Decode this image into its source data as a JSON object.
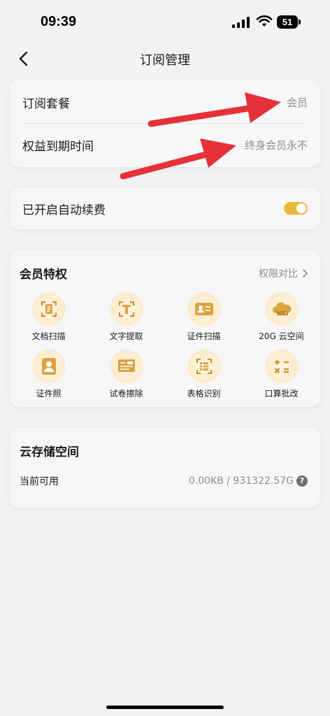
{
  "status": {
    "time": "09:39",
    "battery": "51"
  },
  "nav": {
    "title": "订阅管理",
    "back_icon": "chevron-left-icon"
  },
  "subscription": {
    "plan_label": "订阅套餐",
    "plan_value": "会员",
    "expiry_label": "权益到期时间",
    "expiry_value": "终身会员永不"
  },
  "auto_renew": {
    "label": "已开启自动续费",
    "enabled": true,
    "toggle_color": "#e8b93c"
  },
  "privileges": {
    "title": "会员特权",
    "compare_label": "权限对比",
    "items": [
      {
        "label": "文档扫描",
        "icon": "document-scan-icon"
      },
      {
        "label": "文字提取",
        "icon": "text-extract-icon"
      },
      {
        "label": "证件扫描",
        "icon": "id-card-scan-icon"
      },
      {
        "label": "20G 云空间",
        "icon": "cloud-storage-icon"
      },
      {
        "label": "证件照",
        "icon": "id-photo-icon"
      },
      {
        "label": "试卷擦除",
        "icon": "exam-erase-icon"
      },
      {
        "label": "表格识别",
        "icon": "table-recognize-icon"
      },
      {
        "label": "口算批改",
        "icon": "calculator-icon"
      }
    ]
  },
  "storage": {
    "title": "云存储空间",
    "available_label": "当前可用",
    "available_value": "0.00KB / 931322.57G"
  },
  "colors": {
    "accent_gold": "#d9a441",
    "annotation_red": "#e5323a"
  }
}
